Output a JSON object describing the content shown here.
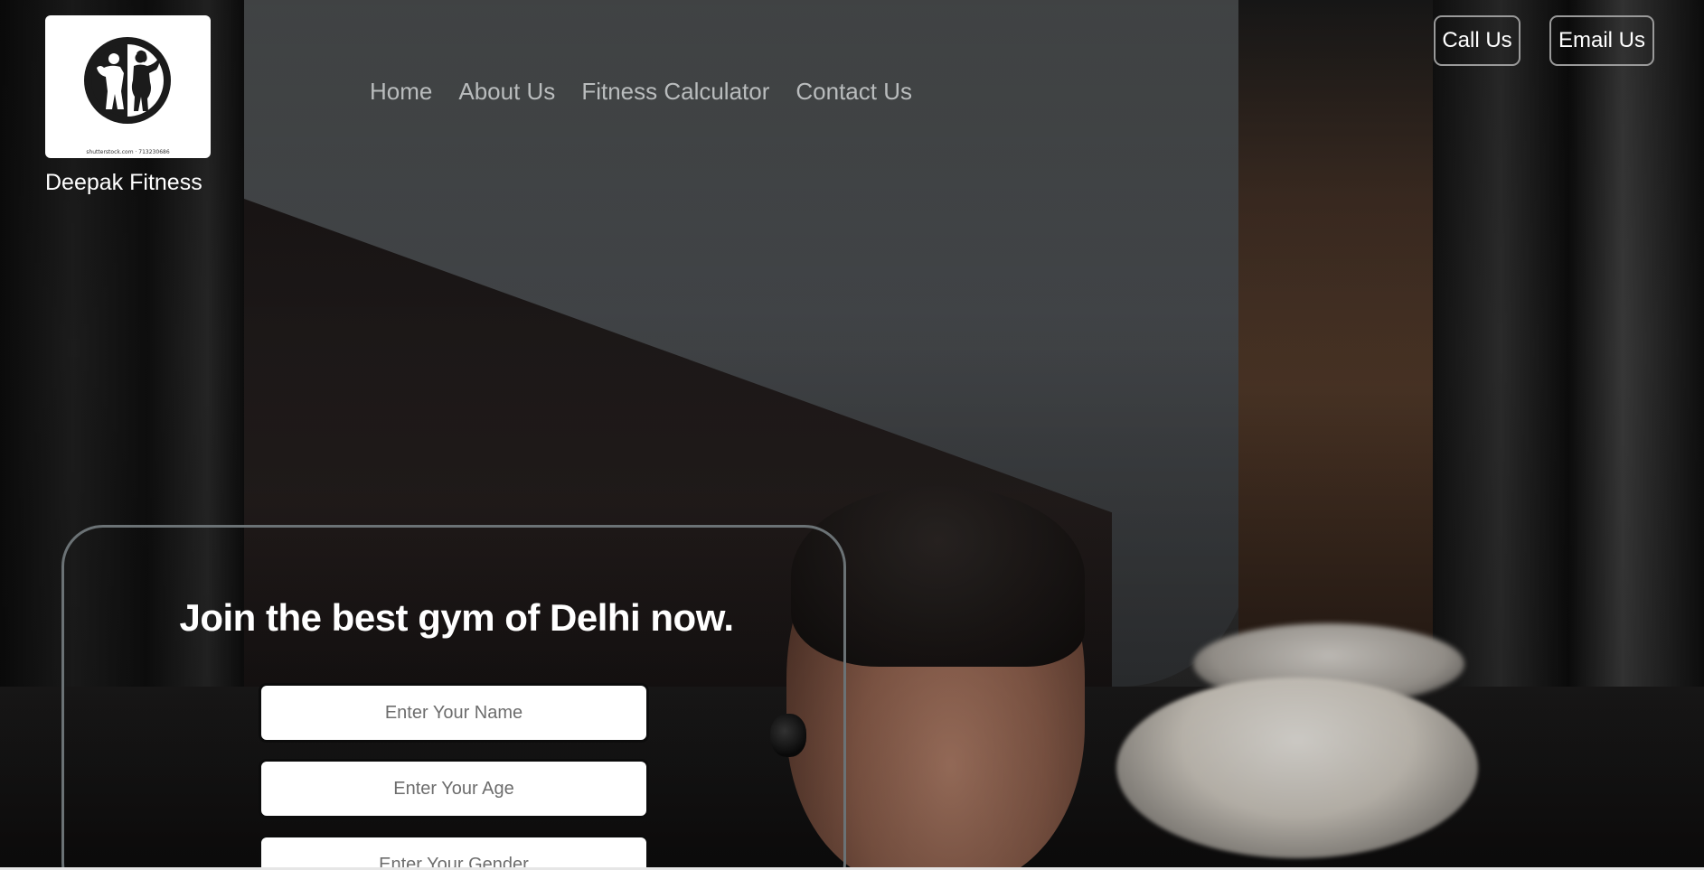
{
  "brand": {
    "name": "Deepak Fitness",
    "logo_caption": "shutterstock.com · 713230686",
    "logo_icon": "fitness-couple-silhouette-icon"
  },
  "nav": {
    "items": [
      {
        "label": "Home"
      },
      {
        "label": "About Us"
      },
      {
        "label": "Fitness Calculator"
      },
      {
        "label": "Contact Us"
      }
    ]
  },
  "actions": {
    "call_label": "Call Us",
    "email_label": "Email Us"
  },
  "join": {
    "title": "Join the best gym of Delhi now.",
    "name_placeholder": "Enter Your Name",
    "age_placeholder": "Enter Your Age",
    "gender_placeholder": "Enter Your Gender"
  },
  "colors": {
    "nav_text": "#b9bcbd",
    "card_border": "#6b7275",
    "button_border": "#9a9a9a"
  }
}
